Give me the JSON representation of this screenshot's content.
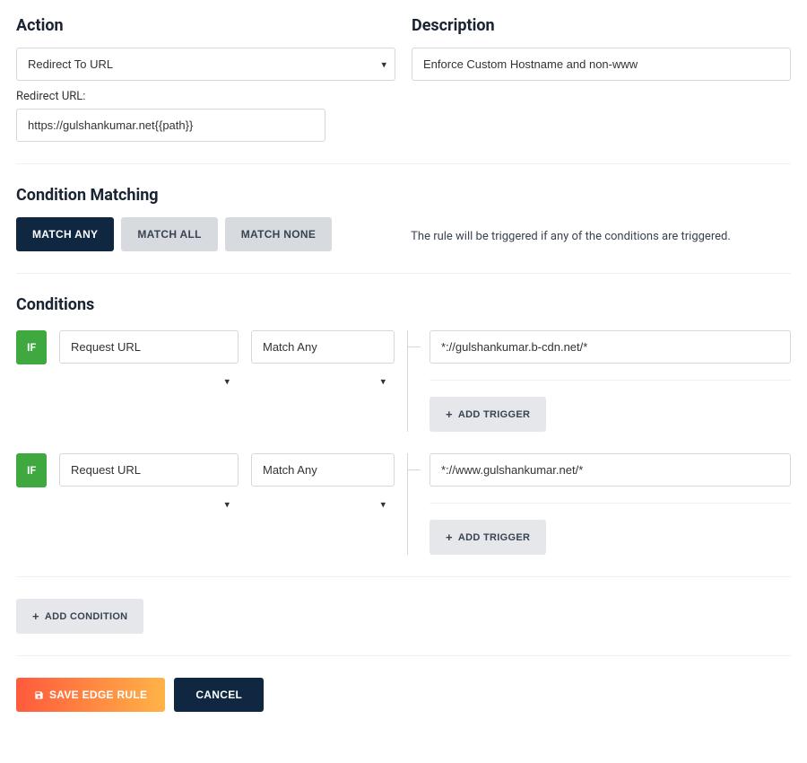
{
  "action": {
    "title": "Action",
    "select_value": "Redirect To URL",
    "redirect_label": "Redirect URL:",
    "redirect_value": "https://gulshankumar.net{{path}}"
  },
  "description": {
    "title": "Description",
    "value": "Enforce Custom Hostname and non-www"
  },
  "condition_matching": {
    "title": "Condition Matching",
    "match_any": "MATCH ANY",
    "match_all": "MATCH ALL",
    "match_none": "MATCH NONE",
    "hint": "The rule will be triggered if any of the conditions are triggered."
  },
  "conditions": {
    "title": "Conditions",
    "if_label": "IF",
    "add_trigger": "ADD TRIGGER",
    "add_condition": "ADD CONDITION",
    "items": [
      {
        "field": "Request URL",
        "match": "Match Any",
        "trigger_value": "*://gulshankumar.b-cdn.net/*"
      },
      {
        "field": "Request URL",
        "match": "Match Any",
        "trigger_value": "*://www.gulshankumar.net/*"
      }
    ]
  },
  "buttons": {
    "save": "SAVE EDGE RULE",
    "cancel": "CANCEL"
  }
}
